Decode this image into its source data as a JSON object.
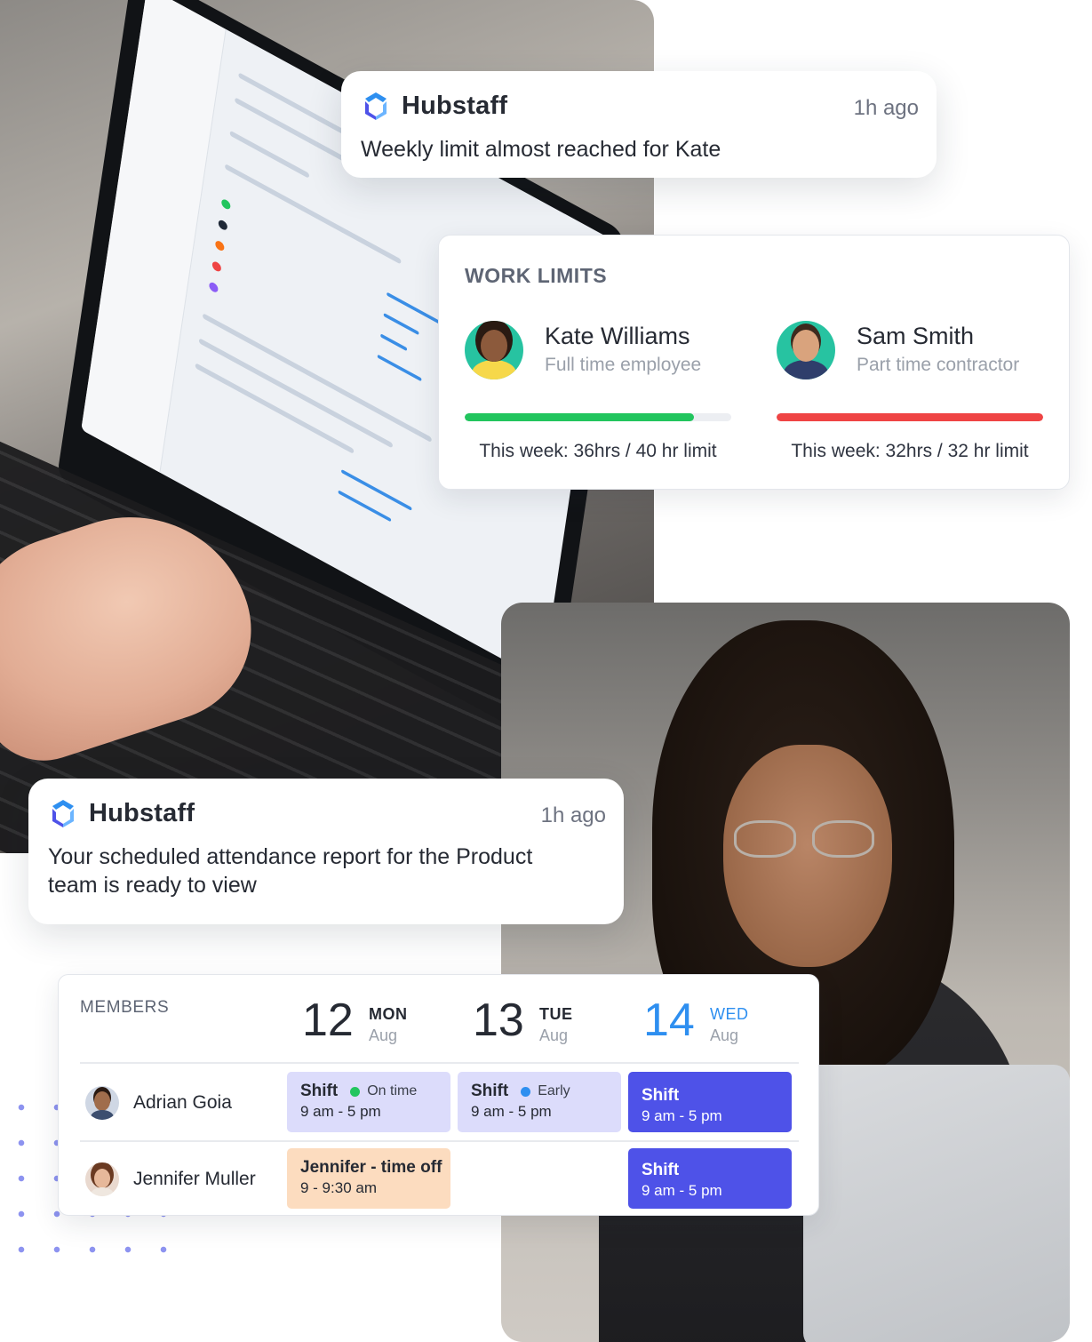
{
  "notifications": [
    {
      "app": "Hubstaff",
      "time": "1h ago",
      "message": "Weekly limit almost reached for Kate",
      "icon": "hubstaff-logo-icon"
    },
    {
      "app": "Hubstaff",
      "time": "1h ago",
      "message": "Your scheduled attendance report for the Product team is ready to view",
      "icon": "hubstaff-logo-icon"
    }
  ],
  "work_limits": {
    "title": "WORK LIMITS",
    "people": [
      {
        "name": "Kate Williams",
        "role": "Full time employee",
        "limit_text": "This week: 36hrs / 40 hr limit",
        "progress": 0.86,
        "progress_color": "#22c55e"
      },
      {
        "name": "Sam Smith",
        "role": "Part time contractor",
        "limit_text": "This week: 32hrs / 32 hr limit",
        "progress": 1.0,
        "progress_color": "#ef4444"
      }
    ]
  },
  "schedule": {
    "members_label": "MEMBERS",
    "days": [
      {
        "num": "12",
        "dow": "MON",
        "month": "Aug"
      },
      {
        "num": "13",
        "dow": "TUE",
        "month": "Aug"
      },
      {
        "num": "14",
        "dow": "WED",
        "month": "Aug",
        "highlight_color": "#2e8ff0"
      }
    ],
    "members": [
      {
        "name": "Adrian Goia",
        "shifts": [
          {
            "title": "Shift",
            "status": "On time",
            "status_color": "#22c55e",
            "time": "9 am - 5 pm"
          },
          {
            "title": "Shift",
            "status": "Early",
            "status_color": "#2e8ff0",
            "time": "9 am - 5 pm"
          },
          {
            "title": "Shift",
            "time": "9 am - 5 pm"
          }
        ]
      },
      {
        "name": "Jennifer Muller",
        "shifts": [
          {
            "title": "Jennifer - time off",
            "time": "9 - 9:30 am"
          },
          null,
          {
            "title": "Shift",
            "time": "9 am - 5 pm"
          }
        ]
      }
    ],
    "colors": {
      "shift_light": "#dcdcfb",
      "shift_dark": "#4e52e8",
      "time_off": "#fcdcbf"
    }
  }
}
